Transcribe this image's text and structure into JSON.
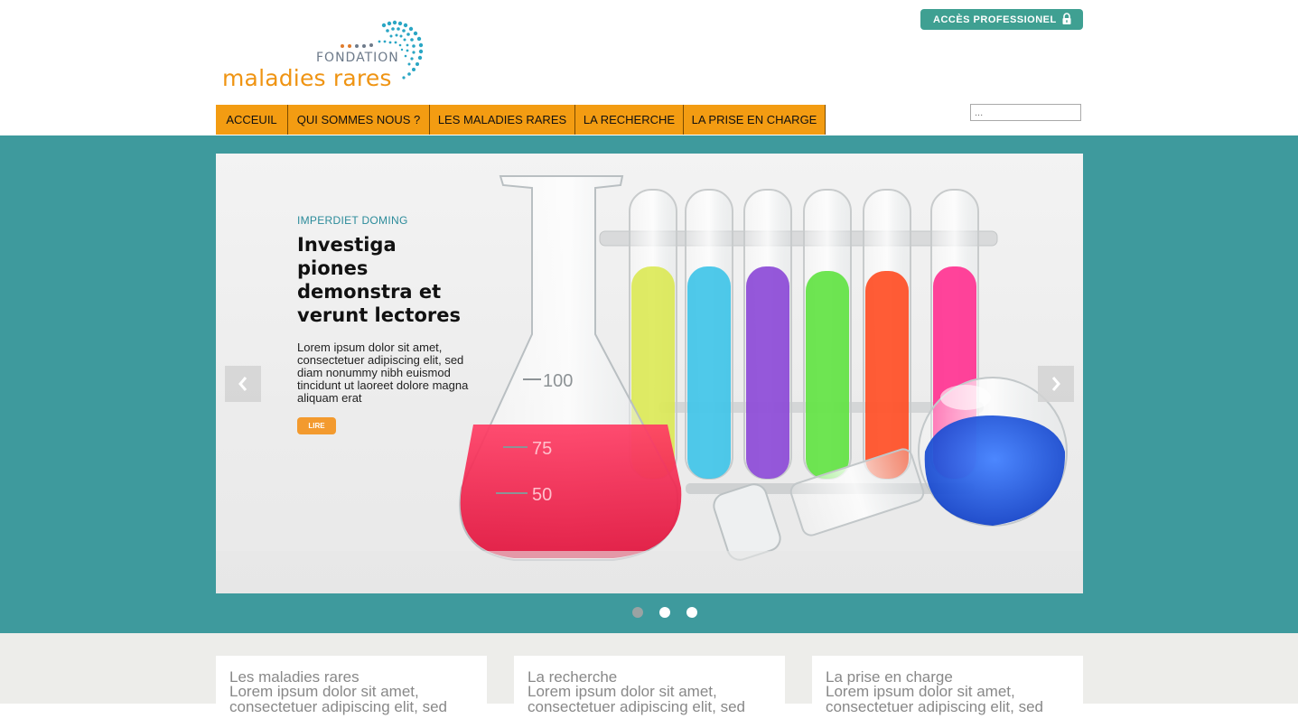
{
  "logo": {
    "fondation": "FONDATION",
    "name": "maladies rares"
  },
  "header": {
    "pro_access_label": "ACCÈS PROFESSIONEL",
    "pro_icon": "lock-icon",
    "search_placeholder": "..."
  },
  "nav": {
    "items": [
      {
        "label": "ACCEUIL"
      },
      {
        "label": "QUI SOMMES NOUS ?"
      },
      {
        "label": "LES MALADIES RARES"
      },
      {
        "label": "LA RECHERCHE"
      },
      {
        "label": "LA PRISE EN CHARGE"
      }
    ]
  },
  "slider": {
    "kicker": "IMPERDIET DOMING",
    "headline": "Investiga piones demonstra et verunt lectores",
    "body": "Lorem ipsum dolor sit amet, consectetuer adipiscing elit, sed diam nonummy nibh euismod tincidunt ut laoreet dolore magna aliquam erat",
    "button_label": "LIRE",
    "prev_icon": "chevron-left-icon",
    "next_icon": "chevron-right-icon",
    "slide_count": 3,
    "active_slide": 1,
    "image_labels": {
      "mark_100": "100",
      "mark_75": "75",
      "mark_50": "50"
    }
  },
  "cards": [
    {
      "title": "Les maladies rares",
      "text": "Lorem ipsum dolor sit amet, consectetuer adipiscing elit, sed"
    },
    {
      "title": "La recherche",
      "text": "Lorem ipsum dolor sit amet, consectetuer adipiscing elit, sed"
    },
    {
      "title": "La prise en charge",
      "text": "Lorem ipsum dolor sit amet, consectetuer adipiscing elit, sed"
    }
  ],
  "colors": {
    "accent_orange": "#f39c12",
    "teal": "#3e9a9d",
    "pro_green": "#3fa092"
  }
}
